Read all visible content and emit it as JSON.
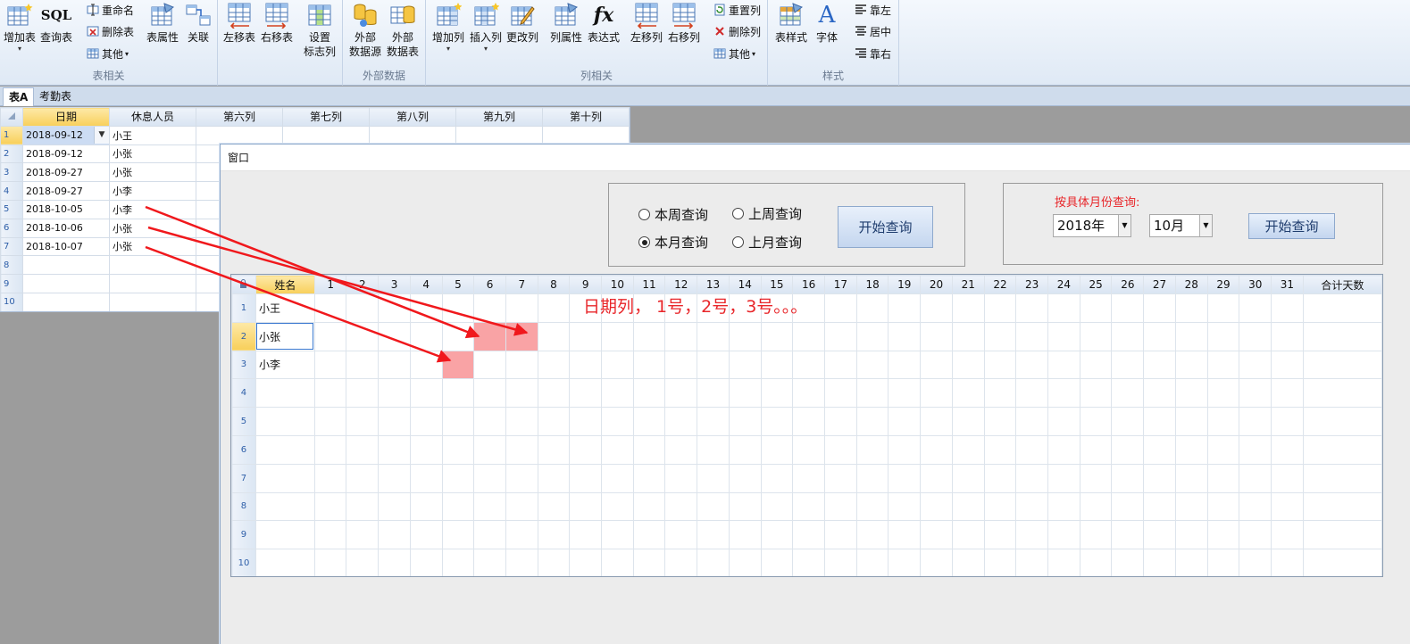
{
  "ribbon": {
    "groups": [
      {
        "label": "表相关"
      },
      {
        "label": "外部数据"
      },
      {
        "label": "列相关"
      },
      {
        "label": "样式"
      }
    ],
    "add_table": "增加表",
    "query_table_icon": "SQL",
    "query_table": "查询表",
    "rename": "重命名",
    "delete_table": "删除表",
    "other1": "其他",
    "table_prop": "表属性",
    "relate": "关联",
    "move_left": "左移表",
    "move_right": "右移表",
    "set_flag_col_1": "设置",
    "set_flag_col_2": "标志列",
    "ext_source_1": "外部",
    "ext_source_2": "数据源",
    "ext_table_1": "外部",
    "ext_table_2": "数据表",
    "add_col": "增加列",
    "insert_col": "插入列",
    "change_col": "更改列",
    "col_prop": "列属性",
    "expression_icon": "fx",
    "expression": "表达式",
    "col_left": "左移列",
    "col_right": "右移列",
    "reset_col": "重置列",
    "delete_col": "删除列",
    "other2": "其他",
    "table_style": "表样式",
    "font_icon": "A",
    "font": "字体",
    "align_left": "靠左",
    "align_center": "居中",
    "align_right": "靠右"
  },
  "tabs": [
    {
      "label": "表A",
      "active": true
    },
    {
      "label": "考勤表",
      "active": false
    }
  ],
  "sheet": {
    "columns": [
      "日期",
      "休息人员",
      "第六列",
      "第七列",
      "第八列",
      "第九列",
      "第十列"
    ],
    "rows": [
      {
        "n": "1",
        "date": "2018-09-12",
        "person": "小王"
      },
      {
        "n": "2",
        "date": "2018-09-12",
        "person": "小张"
      },
      {
        "n": "3",
        "date": "2018-09-27",
        "person": "小张"
      },
      {
        "n": "4",
        "date": "2018-09-27",
        "person": "小李"
      },
      {
        "n": "5",
        "date": "2018-10-05",
        "person": "小李"
      },
      {
        "n": "6",
        "date": "2018-10-06",
        "person": "小张"
      },
      {
        "n": "7",
        "date": "2018-10-07",
        "person": "小张"
      },
      {
        "n": "8",
        "date": "",
        "person": ""
      },
      {
        "n": "9",
        "date": "",
        "person": ""
      },
      {
        "n": "10",
        "date": "",
        "person": ""
      }
    ]
  },
  "dialog": {
    "title": "窗口",
    "radios": [
      {
        "label": "本周查询",
        "checked": false
      },
      {
        "label": "上周查询",
        "checked": false
      },
      {
        "label": "本月查询",
        "checked": true
      },
      {
        "label": "上月查询",
        "checked": false
      }
    ],
    "start_query_1": "开始查询",
    "month_query_label": "按具体月份查询:",
    "year_value": "2018年",
    "month_value": "10月",
    "start_query_2": "开始查询",
    "grid": {
      "corner_icon": "lock-icon",
      "name_header": "姓名",
      "days": [
        "1",
        "2",
        "3",
        "4",
        "5",
        "6",
        "7",
        "8",
        "9",
        "10",
        "11",
        "12",
        "13",
        "14",
        "15",
        "16",
        "17",
        "18",
        "19",
        "20",
        "21",
        "22",
        "23",
        "24",
        "25",
        "26",
        "27",
        "28",
        "29",
        "30",
        "31"
      ],
      "total_header": "合计天数",
      "rows": [
        {
          "n": "1",
          "name": "小王"
        },
        {
          "n": "2",
          "name": "小张"
        },
        {
          "n": "3",
          "name": "小李"
        },
        {
          "n": "4",
          "name": ""
        },
        {
          "n": "5",
          "name": ""
        },
        {
          "n": "6",
          "name": ""
        },
        {
          "n": "7",
          "name": ""
        },
        {
          "n": "8",
          "name": ""
        },
        {
          "n": "9",
          "name": ""
        },
        {
          "n": "10",
          "name": ""
        }
      ],
      "marked_days": {
        "2": [
          "6",
          "7"
        ],
        "3": [
          "5"
        ]
      }
    },
    "annotation": "日期列， 1号，2号，3号。。。"
  },
  "colors": {
    "accent_red": "#e8262a",
    "mark_pink": "#f9a3a5",
    "header_highlight": "#f8cf5a",
    "ribbon_bg": "#dfe9f5"
  }
}
